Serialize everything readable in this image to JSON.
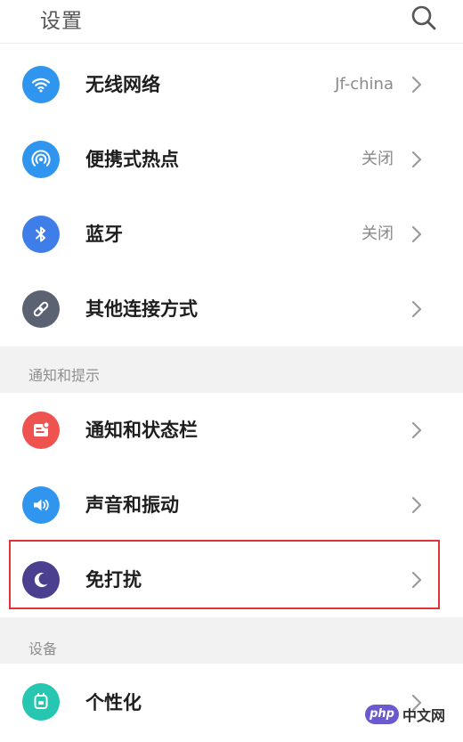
{
  "header": {
    "title": "设置",
    "search_icon": "search-icon"
  },
  "colors": {
    "wifi": "#2f95ee",
    "hotspot": "#2f95ee",
    "bluetooth": "#3f7ee8",
    "other_connection": "#5b6373",
    "notification": "#ef5350",
    "sound": "#2f95ee",
    "dnd": "#4b3f8f",
    "personalize": "#26c6b0",
    "highlight": "#e0323a"
  },
  "connections": [
    {
      "label": "无线网络",
      "value": "Jf-china",
      "icon": "wifi-icon"
    },
    {
      "label": "便携式热点",
      "value": "关闭",
      "icon": "hotspot-icon"
    },
    {
      "label": "蓝牙",
      "value": "关闭",
      "icon": "bluetooth-icon"
    },
    {
      "label": "其他连接方式",
      "value": "",
      "icon": "link-icon"
    }
  ],
  "notification_section": {
    "title": "通知和提示",
    "items": [
      {
        "label": "通知和状态栏",
        "icon": "notification-icon"
      },
      {
        "label": "声音和振动",
        "icon": "speaker-icon"
      },
      {
        "label": "免打扰",
        "icon": "moon-icon"
      }
    ]
  },
  "device_section": {
    "title": "设备",
    "items": [
      {
        "label": "个性化",
        "icon": "personalize-icon"
      }
    ]
  },
  "watermark": {
    "badge": "php",
    "text": "中文网"
  }
}
